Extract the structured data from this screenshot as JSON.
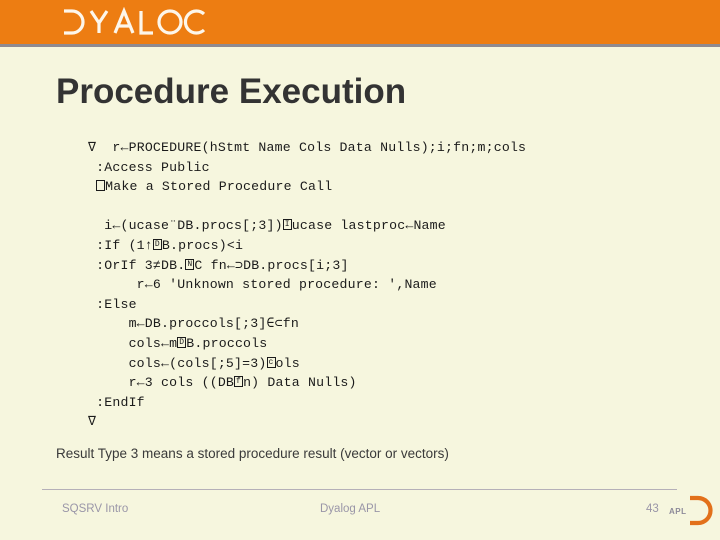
{
  "header": {
    "brand": "DYALOG",
    "brand_color": "#ed7d12",
    "rule_color": "#8f8a90"
  },
  "title": "Procedure Execution",
  "code": {
    "lines": [
      "∇  r←PROCEDURE(hStmt Name Cols Data Nulls);i;fn;m;cols",
      " :Access Public",
      " □Make a Stored Procedure Call",
      "",
      "  i←(ucase¨DB.procs[;3])□ucase lastproc←Name",
      " :If (1↑□B.procs)<i",
      " :OrIf 3≠DB.□C fn←⊃DB.procs[i;3]",
      "      r←6 'Unknown stored procedure: ',Name",
      " :Else",
      "     m←DB.proccols[;3]∈⊂fn",
      "     cols←m□B.proccols",
      "     cols←(cols[;5]=3)□ols",
      "     r←3 cols ((DB□n) Data Nulls)",
      " :EndIf",
      "∇"
    ]
  },
  "caption": "Result Type 3 means a stored procedure result (vector or vectors)",
  "footer": {
    "left": "SQSRV Intro",
    "center": "Dyalog APL",
    "page": "43",
    "logo_text": "APL",
    "logo_color": "#e2701a",
    "text_color": "#9a96a8"
  }
}
